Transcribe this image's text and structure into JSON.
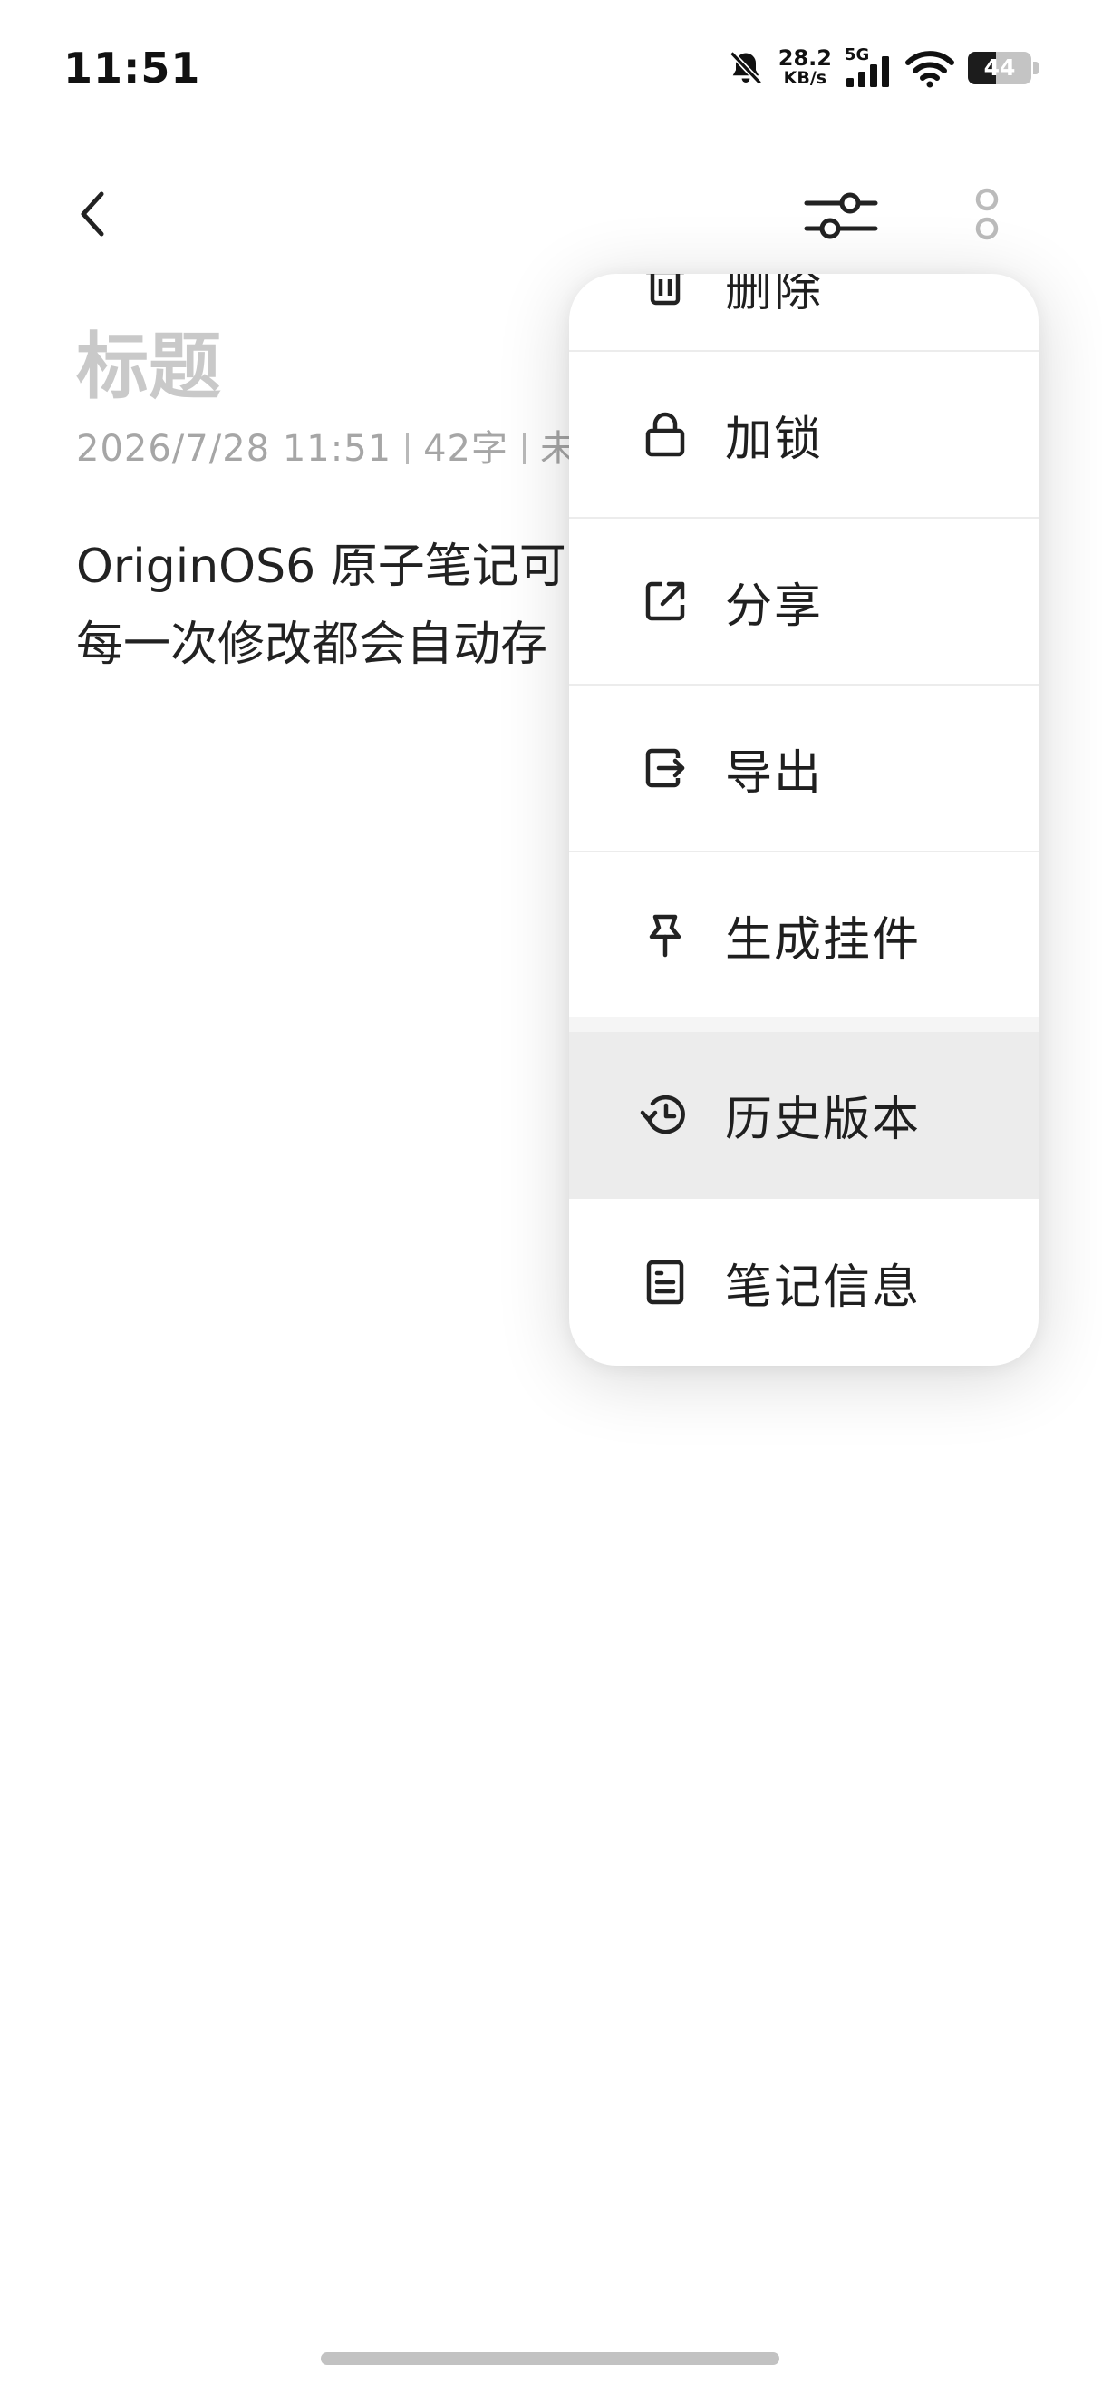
{
  "status_bar": {
    "time": "11:51",
    "net_speed_value": "28.2",
    "net_speed_unit": "KB/s",
    "network_generation": "5G",
    "battery_level": "44",
    "battery_fraction": 0.44,
    "icons": [
      "bell-muted-icon",
      "signal-bars-icon",
      "wifi-icon",
      "battery-icon"
    ]
  },
  "toolbar": {
    "back_icon": "chevron-left-icon",
    "format_icon": "sliders-icon",
    "more_icon": "more-vertical-icon"
  },
  "note": {
    "title_placeholder": "标题",
    "date": "2026/7/28 11:51",
    "word_count": "42字",
    "meta_tail": "未",
    "body_lines": [
      "OriginOS6 原子笔记可",
      "每一次修改都会自动存"
    ]
  },
  "menu": {
    "items": [
      {
        "label": "删除",
        "icon": "trash-icon",
        "partial": true
      },
      {
        "label": "加锁",
        "icon": "lock-icon"
      },
      {
        "label": "分享",
        "icon": "share-icon"
      },
      {
        "label": "导出",
        "icon": "export-icon"
      },
      {
        "label": "生成挂件",
        "icon": "pin-icon"
      },
      {
        "label": "历史版本",
        "icon": "history-icon",
        "highlighted": true
      },
      {
        "label": "笔记信息",
        "icon": "note-info-icon"
      }
    ]
  },
  "colors": {
    "background": "#ffffff",
    "text_primary": "#1f1f1f",
    "text_placeholder": "#c9c9c9",
    "text_meta": "#a6a6a6",
    "menu_highlight": "#ececec"
  }
}
